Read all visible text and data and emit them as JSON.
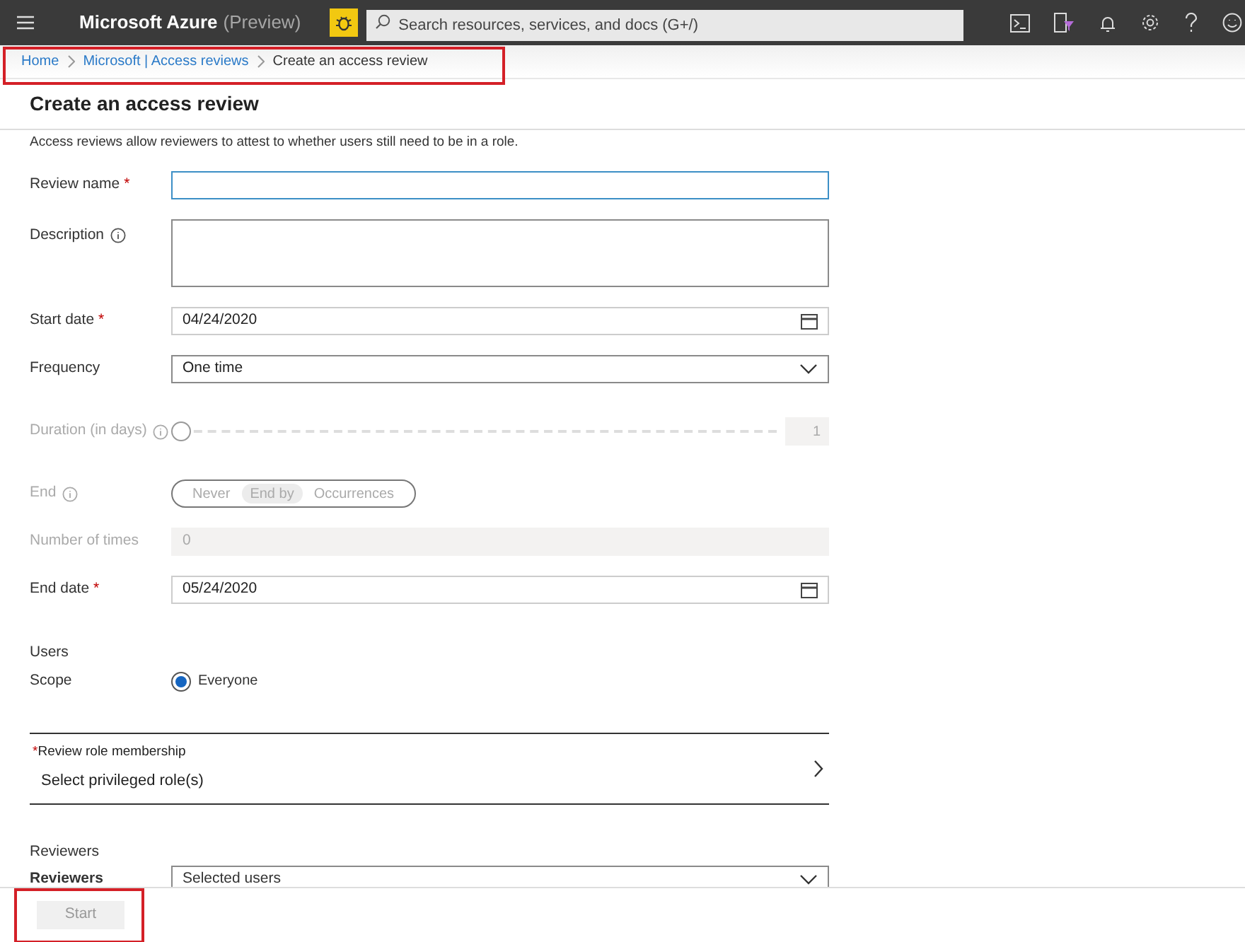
{
  "top_bar": {
    "brand": "Microsoft Azure",
    "brand_suffix": "(Preview)",
    "search": {
      "placeholder": "Search resources, services, and docs (G+/)"
    }
  },
  "breadcrumb": {
    "highlighted": true,
    "items": [
      {
        "label": "Home",
        "current": false
      },
      {
        "label": "Microsoft | Access reviews",
        "current": false
      },
      {
        "label": "Create an access review",
        "current": true
      }
    ]
  },
  "page_title": "Create an access review",
  "intro": "Access reviews allow reviewers to attest to whether users still need to be in a role.",
  "fields": [
    {
      "kind": "text",
      "label": "Review name",
      "required_mark": "*",
      "info": false,
      "disabled": false
    },
    {
      "kind": "textarea",
      "label": "Description",
      "info": true,
      "disabled": false
    },
    {
      "kind": "date",
      "label": "Start date",
      "required_mark": "*",
      "info": false,
      "disabled": false,
      "value": "04/24/2020"
    },
    {
      "kind": "select",
      "label": "Frequency",
      "info": false,
      "disabled": false,
      "value": "One time"
    },
    {
      "kind": "slider",
      "label": "Duration (in days)",
      "info": true,
      "disabled": true,
      "level": 0,
      "reading": "1"
    },
    {
      "kind": "segmented",
      "label": "End",
      "info": true,
      "disabled": true,
      "options": [
        {
          "label": "Never",
          "selected": false
        },
        {
          "label": "End by",
          "selected": true
        },
        {
          "label": "Occurrences",
          "selected": false
        }
      ]
    },
    {
      "kind": "number",
      "label": "Number of times",
      "info": false,
      "disabled": true,
      "value": "0"
    },
    {
      "kind": "date",
      "label": "End date",
      "required_mark": "*",
      "info": false,
      "disabled": false,
      "value": "05/24/2020"
    }
  ],
  "users": {
    "heading": "Users",
    "scope_label": "Scope",
    "options": [
      {
        "label": "Everyone",
        "selected": true
      }
    ]
  },
  "role_membership": {
    "label": "Review role membership",
    "required_mark": "*",
    "value": "Select privileged role(s)"
  },
  "reviewers": {
    "heading": "Reviewers",
    "label": "Reviewers",
    "value": "Selected users"
  },
  "footer": {
    "start_button": {
      "label": "Start",
      "disabled": true,
      "highlighted": true
    }
  }
}
